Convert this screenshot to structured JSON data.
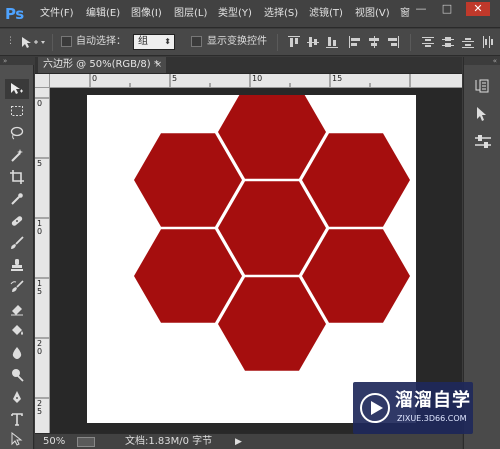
{
  "app": {
    "logo_text": "Ps"
  },
  "menu": {
    "items": [
      "文件(F)",
      "编辑(E)",
      "图像(I)",
      "图层(L)",
      "类型(Y)",
      "选择(S)",
      "滤镜(T)",
      "视图(V)",
      "窗"
    ]
  },
  "window_controls": {
    "minimize": "—",
    "restore": "□",
    "close": "✕"
  },
  "options": {
    "auto_select_label": "自动选择：",
    "auto_select_value": "组",
    "show_transform_label": "显示变换控件"
  },
  "document": {
    "tab_title": "六边形 @ 50%(RGB/8) *",
    "tab_close": "×",
    "zoom": "50%",
    "doc_size": "文档:1.83M/0 字节",
    "status_arrow": "▶",
    "ruler_top_labels": [
      "0",
      "5",
      "10",
      "15"
    ],
    "ruler_left_labels": [
      "0",
      "5",
      "1 0",
      "1 5",
      "2 0",
      "2 5"
    ],
    "artwork": {
      "shape": "hexagon",
      "fill_color": "#a50e0e",
      "count": 7
    }
  },
  "watermark": {
    "title": "溜溜自学",
    "url": "ZIXUE.3D66.COM"
  }
}
